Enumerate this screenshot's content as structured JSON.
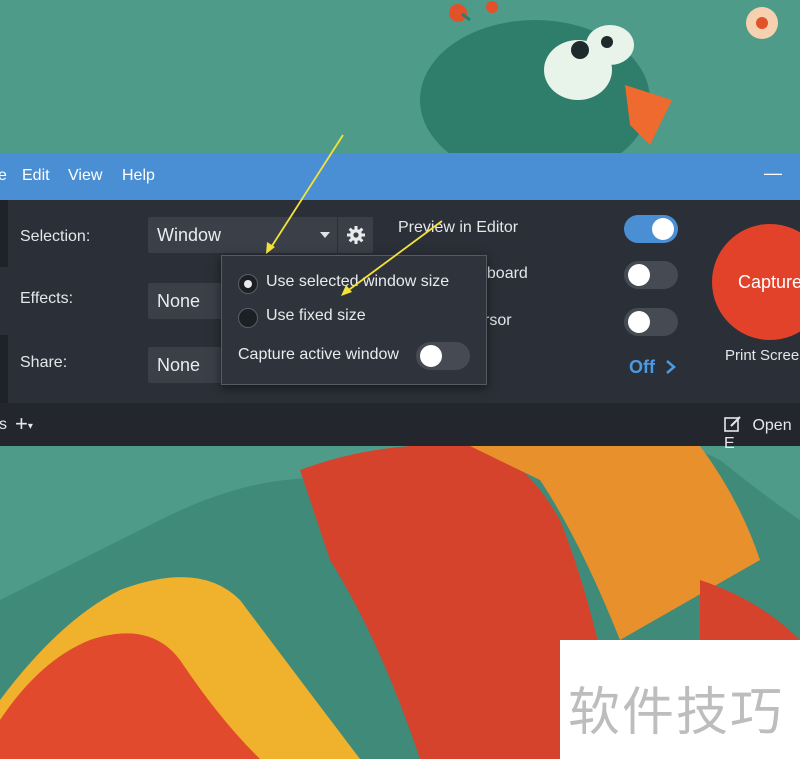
{
  "menu": {
    "file": "e",
    "edit": "Edit",
    "view": "View",
    "help": "Help",
    "minimize": "—"
  },
  "settings": {
    "selection_label": "Selection:",
    "selection_value": "Window",
    "effects_label": "Effects:",
    "effects_value": "None",
    "share_label": "Share:",
    "share_value": "None"
  },
  "options": {
    "preview_label": "Preview in Editor",
    "preview_on": true,
    "clipboard_label": "oboard",
    "clipboard_on": false,
    "cursor_label": "rsor",
    "cursor_on": false,
    "off_label": "Off"
  },
  "capture": {
    "button_label": "Capture",
    "hotkey": "Print Scree"
  },
  "bottom": {
    "presets_label": "s",
    "add_label": "+",
    "open_label": "Open E"
  },
  "popup": {
    "option1": "Use selected window size",
    "option1_checked": true,
    "option2": "Use fixed size",
    "option2_checked": false,
    "active_window_label": "Capture active window",
    "active_window_on": false
  },
  "watermark": {
    "text": "软件技巧"
  },
  "colors": {
    "accent": "#4a8fd4",
    "capture_red": "#e2412a",
    "panel": "#2b2f37",
    "arrow": "#f2e23a"
  }
}
